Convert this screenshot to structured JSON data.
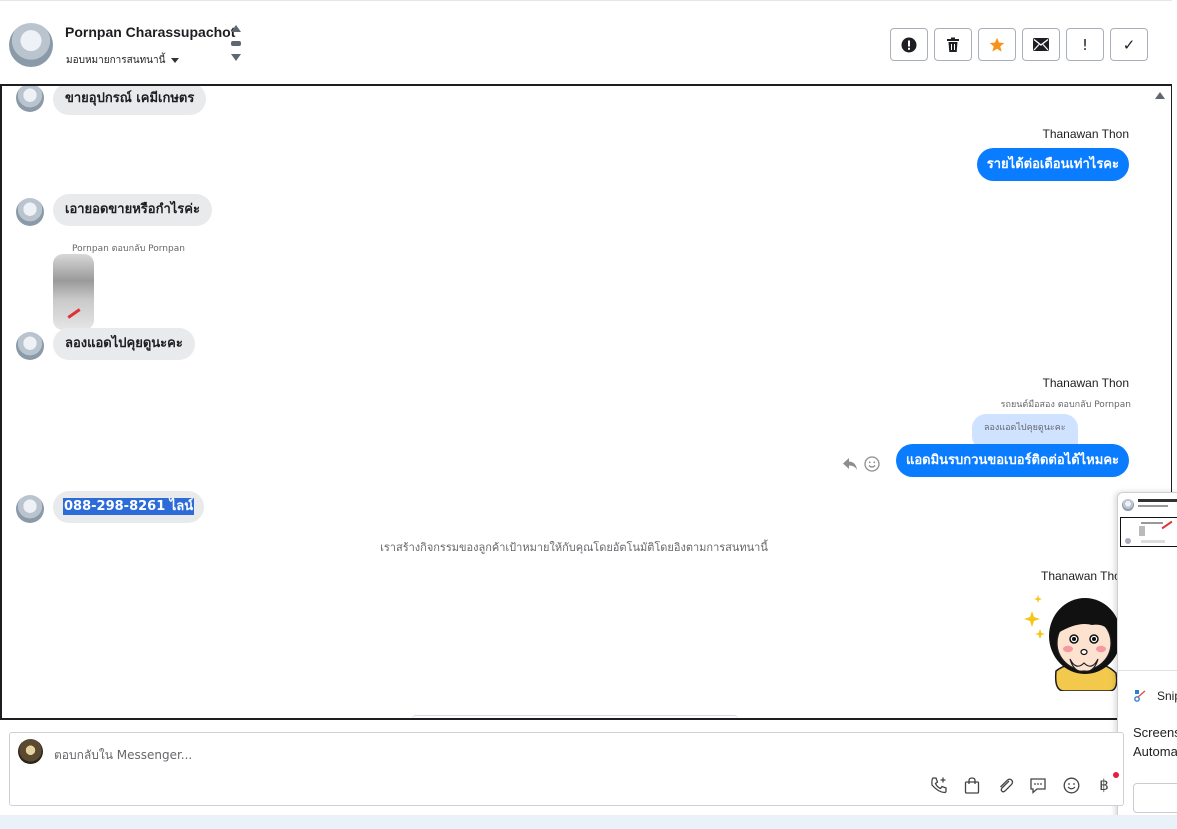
{
  "header": {
    "contact_name": "Pornpan Charassupachot",
    "assign_label": "มอบหมายการสนทนานี้",
    "actions": [
      {
        "icon": "alert-circle-icon",
        "label": ""
      },
      {
        "icon": "trash-icon",
        "label": ""
      },
      {
        "icon": "star-icon",
        "label": ""
      },
      {
        "icon": "envelope-icon",
        "label": ""
      },
      {
        "icon": "exclamation-icon",
        "label": "!"
      },
      {
        "icon": "checkmark-icon",
        "label": "✓"
      }
    ],
    "star_color": "#f7931a"
  },
  "messages": {
    "m1": "ขายอุปกรณ์ เคมีเกษตร",
    "sender1": "Thanawan Thon",
    "m2": "รายได้ต่อเดือนเท่าไรคะ",
    "m3": "เอายอดขายหรือกำไรค่ะ",
    "reply_meta_in": "Pornpan ตอบกลับ Pornpan",
    "m4": "ลองแอดไปคุยดูนะคะ",
    "sender2": "Thanawan Thon",
    "reply_meta_out": "รถยนต์มือสอง ตอบกลับ Pornpan",
    "quoted": "ลองแอดไปคุยดูนะคะ",
    "m5": "แอดมินรบกวนขอเบอร์ติดต่อได้ไหมคะ",
    "m6": "088-298-8261 ไลน์",
    "system_note": "เราสร้างกิจกรรมของลูกค้าเป้าหมายให้กับคุณโดยอัตโนมัติโดยอิงตามการสนทนานี้",
    "sender3": "Thanawan Tho"
  },
  "snip_popup": {
    "title": "Snip",
    "line1": "Screens",
    "line2": "Automa"
  },
  "composer": {
    "placeholder": "ตอบกลับใน Messenger...",
    "tools": [
      "phone-plus-icon",
      "shopping-bag-icon",
      "paperclip-icon",
      "chat-bubble-icon",
      "emoji-icon",
      "baht-icon"
    ],
    "baht": "฿"
  },
  "colors": {
    "outgoing": "#0a7cff",
    "incoming": "#e9eaec",
    "quoted": "#cfe2ff",
    "selection": "#2c6bd8"
  }
}
